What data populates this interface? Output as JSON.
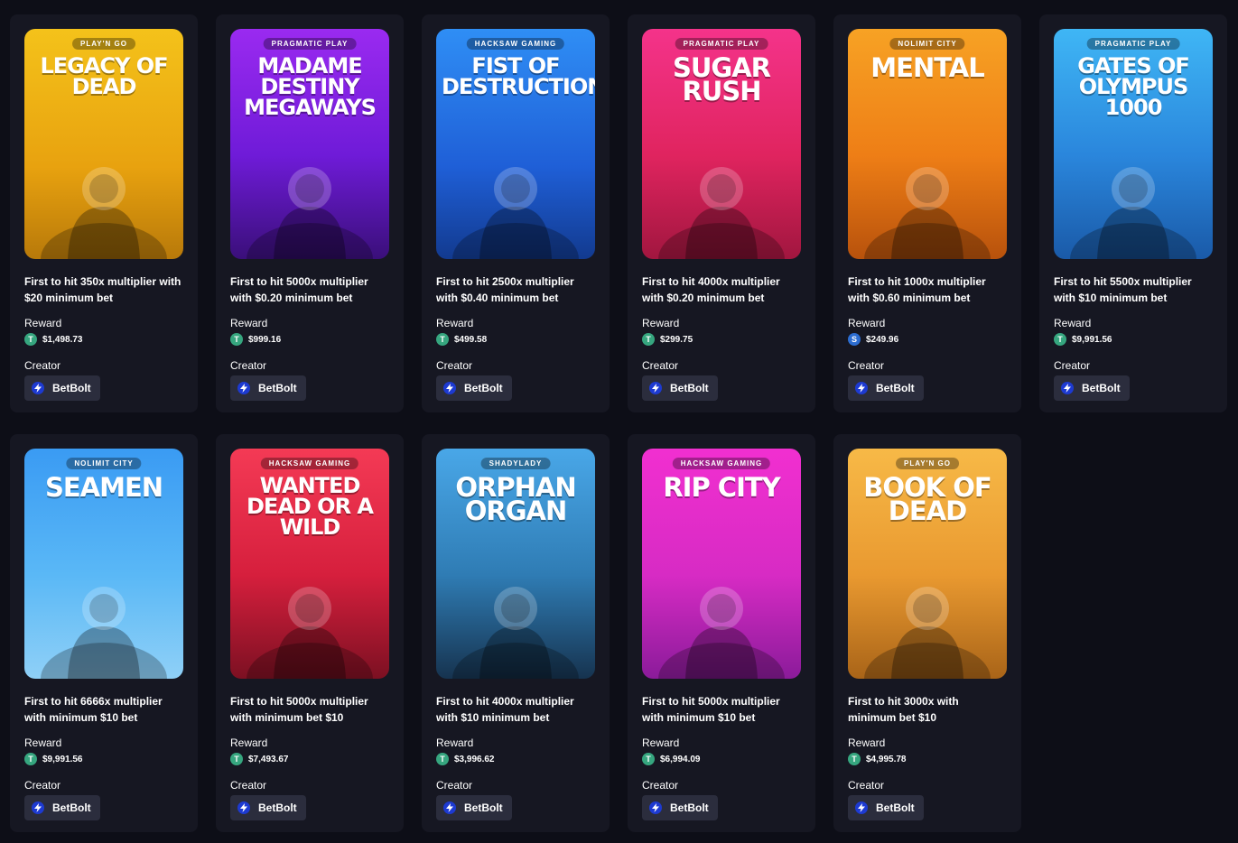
{
  "cards": [
    {
      "provider": "PLAY'N GO",
      "title": "LEGACY OF DEAD",
      "theme": "yellow",
      "description": "First to hit 350x multiplier with $20 minimum bet",
      "reward_label": "Reward",
      "reward": "$1,498.73",
      "coin": "T",
      "creator_label": "Creator",
      "creator": "BetBolt"
    },
    {
      "provider": "PRAGMATIC PLAY",
      "title": "MADAME DESTINY MEGAWAYS",
      "theme": "purple",
      "description": "First to hit 5000x multiplier with $0.20 minimum bet",
      "reward_label": "Reward",
      "reward": "$999.16",
      "coin": "T",
      "creator_label": "Creator",
      "creator": "BetBolt"
    },
    {
      "provider": "HACKSAW GAMING",
      "title": "FIST OF DESTRUCTION",
      "theme": "blue",
      "description": "First to hit 2500x multiplier with $0.40 minimum bet",
      "reward_label": "Reward",
      "reward": "$499.58",
      "coin": "T",
      "creator_label": "Creator",
      "creator": "BetBolt"
    },
    {
      "provider": "PRAGMATIC PLAY",
      "title": "SUGAR RUSH",
      "theme": "pink",
      "description": "First to hit 4000x multiplier with $0.20 minimum bet",
      "reward_label": "Reward",
      "reward": "$299.75",
      "coin": "T",
      "creator_label": "Creator",
      "creator": "BetBolt"
    },
    {
      "provider": "NOLIMIT CITY",
      "title": "MENTAL",
      "theme": "orange",
      "description": "First to hit 1000x multiplier with $0.60 minimum bet",
      "reward_label": "Reward",
      "reward": "$249.96",
      "coin": "S",
      "creator_label": "Creator",
      "creator": "BetBolt"
    },
    {
      "provider": "PRAGMATIC PLAY",
      "title": "GATES OF OLYMPUS 1000",
      "theme": "sky",
      "description": "First to hit 5500x multiplier with $10 minimum bet",
      "reward_label": "Reward",
      "reward": "$9,991.56",
      "coin": "T",
      "creator_label": "Creator",
      "creator": "BetBolt"
    },
    {
      "provider": "NOLIMIT CITY",
      "title": "SEAMEN",
      "theme": "lblue",
      "description": "First to hit 6666x multiplier with minimum $10 bet",
      "reward_label": "Reward",
      "reward": "$9,991.56",
      "coin": "T",
      "creator_label": "Creator",
      "creator": "BetBolt"
    },
    {
      "provider": "HACKSAW GAMING",
      "title": "WANTED DEAD OR A WILD",
      "theme": "red",
      "description": "First to hit 5000x multiplier with minimum bet $10",
      "reward_label": "Reward",
      "reward": "$7,493.67",
      "coin": "T",
      "creator_label": "Creator",
      "creator": "BetBolt"
    },
    {
      "provider": "SHADYLADY",
      "title": "ORPHAN ORGAN",
      "theme": "teal",
      "description": "First to hit 4000x multiplier with $10 minimum bet",
      "reward_label": "Reward",
      "reward": "$3,996.62",
      "coin": "T",
      "creator_label": "Creator",
      "creator": "BetBolt"
    },
    {
      "provider": "HACKSAW GAMING",
      "title": "RIP CITY",
      "theme": "magenta",
      "description": "First to hit 5000x multiplier with minimum $10 bet",
      "reward_label": "Reward",
      "reward": "$6,994.09",
      "coin": "T",
      "creator_label": "Creator",
      "creator": "BetBolt"
    },
    {
      "provider": "PLAY'N GO",
      "title": "BOOK OF DEAD",
      "theme": "gold",
      "description": "First to hit 3000x with minimum bet $10",
      "reward_label": "Reward",
      "reward": "$4,995.78",
      "coin": "T",
      "creator_label": "Creator",
      "creator": "BetBolt"
    }
  ],
  "icons": {
    "reward_coin": "tether-coin-icon",
    "reward_coin_alt": "usdc-coin-icon",
    "creator_badge": "lightning-bolt-icon"
  }
}
